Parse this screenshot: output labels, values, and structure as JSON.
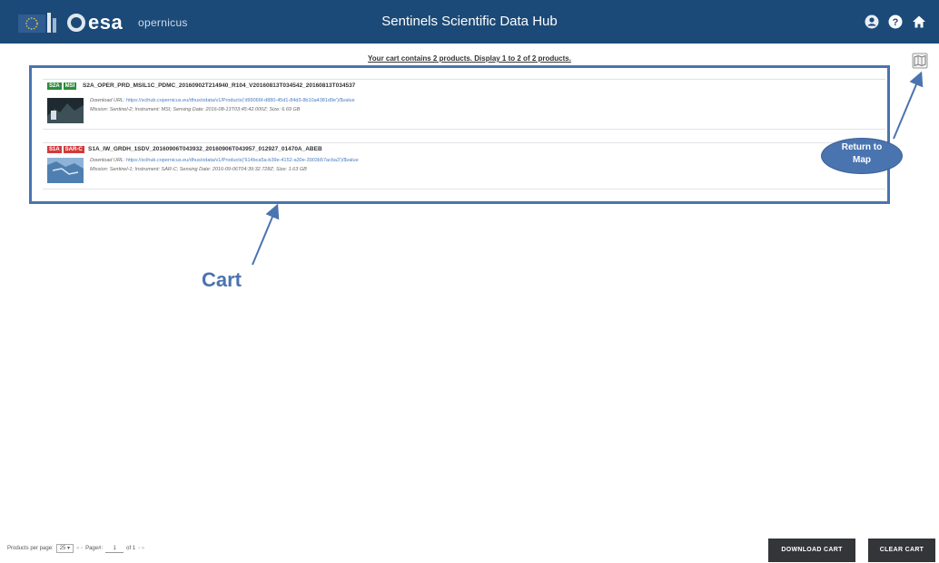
{
  "header": {
    "logo_text": "esa",
    "brand_text": "opernicus",
    "title": "Sentinels Scientific Data Hub",
    "icons": [
      "user-icon",
      "help-icon",
      "home-icon"
    ],
    "bar_color": "#1c4a78"
  },
  "cart": {
    "summary": "Your cart contains 2 products. Display 1 to 2 of 2 products.",
    "return_icon": "map-icon",
    "products": [
      {
        "badges": [
          "S2A",
          "MSI"
        ],
        "badge_color": "#2e8b3c",
        "name": "S2A_OPER_PRD_MSIL1C_PDMC_20160902T214940_R104_V20160813T034542_20160813T034537",
        "download_url_label": "Download URL:",
        "download_url": "https://scihub.copernicus.eu/dhus/odata/v1/Products('d99066f-d880-45d1-84d3-8b10a4381d9e')/$value",
        "details": "Mission: Sentinel-2; Instrument: MSI; Sensing Date: 2016-08-13T03:45:42.000Z; Size: 6.69 GB"
      },
      {
        "badges": [
          "S1A",
          "SAR-C"
        ],
        "badge_color": "#d23a3a",
        "name": "S1A_IW_GRDH_1SDV_20160906T043932_20160906T043957_012927_01470A_ABEB",
        "download_url_label": "Download URL:",
        "download_url": "https://scihub.copernicus.eu/dhus/odata/v1/Products('614bca5a-b39e-4152-a30e-3903b57acba3')/$value",
        "details": "Mission: Sentinel-1; Instrument: SAR-C; Sensing Date: 2016-09-06T04:39:32.728Z; Size: 1.63 GB"
      }
    ]
  },
  "annotations": {
    "cart_label": "Cart",
    "return_label_line1": "Return to",
    "return_label_line2": "Map",
    "color": "#4a74b0"
  },
  "footer": {
    "per_page_label": "Products per page:",
    "per_page_value": "25",
    "nav_prev": "« ‹",
    "page_label": "Page#:",
    "page_value": "1",
    "of_label": "of 1",
    "nav_next": "› »",
    "download_button": "DOWNLOAD CART",
    "clear_button": "CLEAR CART"
  }
}
